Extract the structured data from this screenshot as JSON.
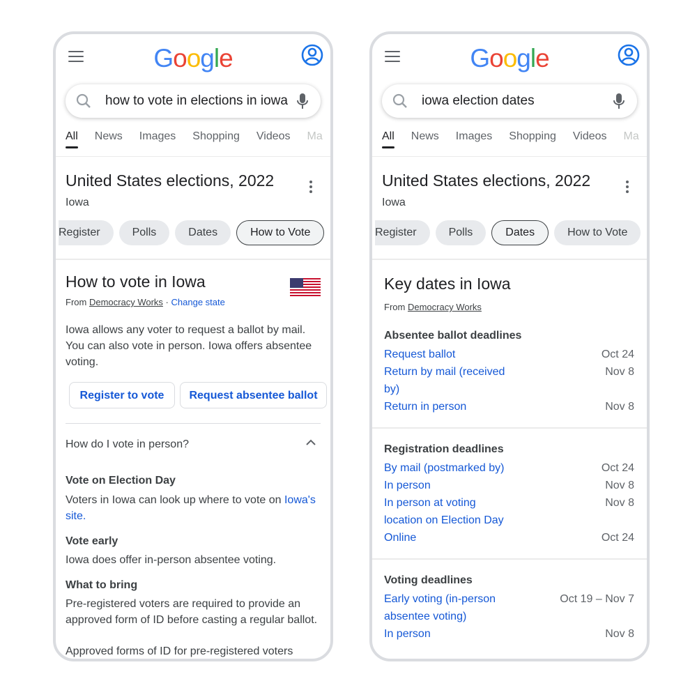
{
  "left": {
    "logo": [
      "G",
      "o",
      "o",
      "g",
      "l",
      "e"
    ],
    "query": "how to vote in elections in iowa",
    "tabs": [
      "All",
      "News",
      "Images",
      "Shopping",
      "Videos",
      "Ma"
    ],
    "card_title": "United States elections, 2022",
    "card_sub": "Iowa",
    "chips": [
      "Register",
      "Polls",
      "Dates",
      "How to Vote"
    ],
    "selected_chip": "How to Vote",
    "section_title": "How to vote in Iowa",
    "from_label": "From",
    "source": "Democracy Works",
    "source_sep": "·",
    "change_state": "Change state",
    "intro": "Iowa allows any voter to request a ballot by mail. You can also vote in person. Iowa offers absentee voting.",
    "register_button": "Register to vote",
    "absentee_button": "Request absentee ballot",
    "faq_question": "How do I vote in person?",
    "election_day_heading": "Vote on Election Day",
    "election_day_text": "Voters in Iowa can look up where to vote on",
    "election_day_link": "Iowa's site.",
    "early_heading": "Vote early",
    "early_text": "Iowa does offer in-person absentee voting.",
    "bring_heading": "What to bring",
    "bring_text": "Pre-registered voters are required to provide an approved form of ID before casting a regular ballot.",
    "approved_text": "Approved forms of ID for pre-registered voters include:"
  },
  "right": {
    "logo": [
      "G",
      "o",
      "o",
      "g",
      "l",
      "e"
    ],
    "query": "iowa election dates",
    "tabs": [
      "All",
      "News",
      "Images",
      "Shopping",
      "Videos",
      "Ma"
    ],
    "card_title": "United States elections, 2022",
    "card_sub": "Iowa",
    "chips": [
      "Register",
      "Polls",
      "Dates",
      "How to Vote"
    ],
    "selected_chip": "Dates",
    "section_title": "Key dates in Iowa",
    "from_label": "From",
    "source": "Democracy Works",
    "absentee_heading": "Absentee ballot deadlines",
    "absentee_rows": [
      {
        "label": "Request ballot",
        "date": "Oct 24"
      },
      {
        "label": "Return by mail (received by)",
        "date": "Nov 8"
      },
      {
        "label": "Return in person",
        "date": "Nov 8"
      }
    ],
    "registration_heading": "Registration deadlines",
    "registration_rows": [
      {
        "label": "By mail (postmarked by)",
        "date": "Oct 24"
      },
      {
        "label": "In person",
        "date": "Nov 8"
      },
      {
        "label": "In person at voting location on Election Day",
        "date": "Nov 8"
      },
      {
        "label": "Online",
        "date": "Oct 24"
      }
    ],
    "voting_heading": "Voting deadlines",
    "voting_rows": [
      {
        "label": "Early voting (in-person absentee voting)",
        "date": "Oct 19 – Nov 7"
      },
      {
        "label": "In person",
        "date": "Nov 8"
      }
    ]
  },
  "colors": {
    "blue": "#4285f4",
    "red": "#ea4335",
    "yellow": "#fbbc05",
    "green": "#34a853",
    "link": "#1558d6"
  },
  "icons": [
    "menu-icon",
    "account-icon",
    "search-icon",
    "mic-icon",
    "more-vert-icon",
    "chevron-up-icon",
    "us-flag-icon"
  ]
}
